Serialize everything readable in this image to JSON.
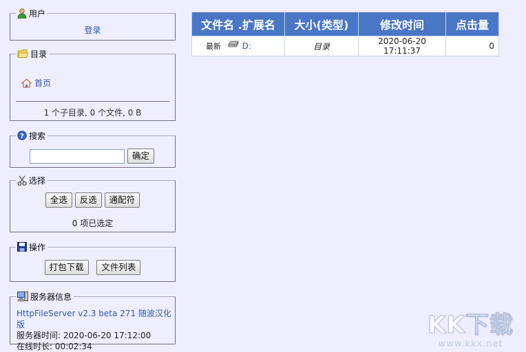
{
  "panels": {
    "user": {
      "title": "用户",
      "login": "登录"
    },
    "dir": {
      "title": "目录",
      "home": "首页",
      "summary": "1 个子目录, 0 个文件, 0 B"
    },
    "search": {
      "title": "搜索",
      "value": "",
      "ok": "确定"
    },
    "select": {
      "title": "选择",
      "all": "全选",
      "invert": "反选",
      "wildcard": "通配符",
      "status": "0 项已选定"
    },
    "actions": {
      "title": "操作",
      "zip": "打包下载",
      "list": "文件列表"
    },
    "server": {
      "title": "服务器信息",
      "version": "HttpFileServer v2.3 beta 271 随波汉化版",
      "time": "服务器时间: 2020-06-20 17:12:00",
      "uptime": "在线时长: 00:02:34"
    }
  },
  "table": {
    "headers": [
      "文件名 .扩展名",
      "大小(类型)",
      "修改时间",
      "点击量"
    ],
    "rows": [
      {
        "badge": "最新",
        "name": "D:",
        "size": "目录",
        "modified": "2020-06-20 17:11:37",
        "hits": "0"
      }
    ]
  },
  "watermark": {
    "logo": "KK下载",
    "url": "www.kkx.net"
  }
}
